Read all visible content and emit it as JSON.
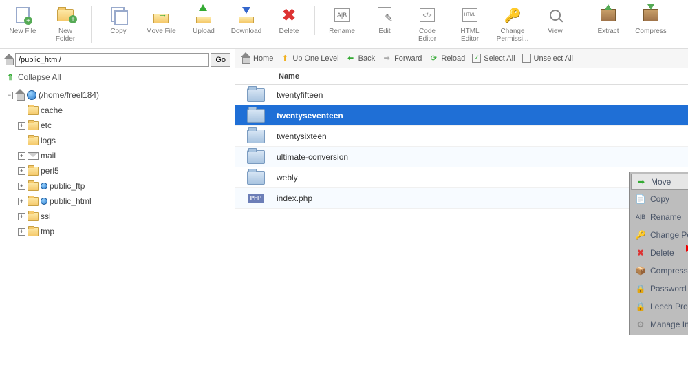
{
  "toolbar": {
    "new_file": "New File",
    "new_folder": "New Folder",
    "copy": "Copy",
    "move_file": "Move File",
    "upload": "Upload",
    "download": "Download",
    "delete": "Delete",
    "rename": "Rename",
    "edit": "Edit",
    "code_editor": "Code Editor",
    "html_editor": "HTML Editor",
    "change_permissions": "Change Permissi...",
    "view": "View",
    "extract": "Extract",
    "compress": "Compress"
  },
  "path": {
    "value": "/public_html/",
    "go": "Go"
  },
  "collapse_all": "Collapse All",
  "tree_root": "(/home/freel184)",
  "tree": [
    {
      "label": "cache"
    },
    {
      "label": "etc"
    },
    {
      "label": "logs"
    },
    {
      "label": "mail"
    },
    {
      "label": "perl5"
    },
    {
      "label": "public_ftp"
    },
    {
      "label": "public_html"
    },
    {
      "label": "ssl"
    },
    {
      "label": "tmp"
    }
  ],
  "nav": {
    "home": "Home",
    "up": "Up One Level",
    "back": "Back",
    "forward": "Forward",
    "reload": "Reload",
    "select_all": "Select All",
    "unselect_all": "Unselect All"
  },
  "grid": {
    "name_header": "Name",
    "rows": [
      {
        "name": "twentyfifteen",
        "type": "folder"
      },
      {
        "name": "twentyseventeen",
        "type": "folder",
        "selected": true
      },
      {
        "name": "twentysixteen",
        "type": "folder"
      },
      {
        "name": "ultimate-conversion",
        "type": "folder"
      },
      {
        "name": "webly",
        "type": "folder"
      },
      {
        "name": "index.php",
        "type": "php"
      }
    ]
  },
  "context_menu": {
    "move": "Move",
    "copy": "Copy",
    "rename": "Rename",
    "change_permissions": "Change Permissions",
    "delete": "Delete",
    "compress": "Compress",
    "password_protect": "Password Protect",
    "leech_protect": "Leech Protect",
    "manage_indices": "Manage Indices"
  }
}
